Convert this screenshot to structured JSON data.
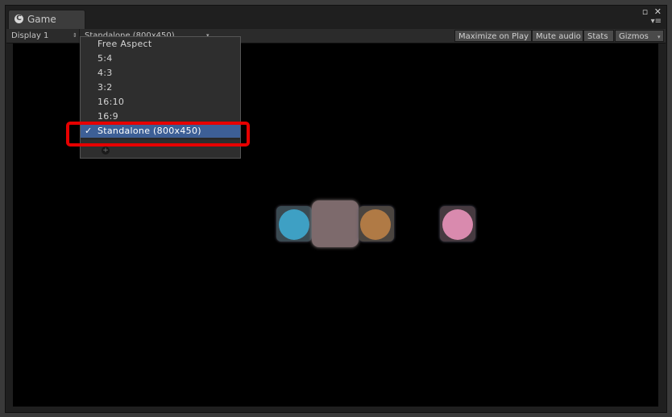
{
  "window": {
    "tab_title": "Game",
    "tab_icon": "unity-logo-icon",
    "controls": {
      "restore": "▫",
      "close": "✕",
      "menu": "▾≡"
    }
  },
  "toolbar": {
    "display": "Display 1",
    "resolution": "Standalone (800x450)",
    "maximize_on_play": "Maximize on Play",
    "mute_audio": "Mute audio",
    "stats": "Stats",
    "gizmos": "Gizmos"
  },
  "aspect_dropdown": {
    "items": [
      {
        "label": "Free Aspect",
        "selected": false
      },
      {
        "label": "5:4",
        "selected": false
      },
      {
        "label": "4:3",
        "selected": false
      },
      {
        "label": "3:2",
        "selected": false
      },
      {
        "label": "16:10",
        "selected": false
      },
      {
        "label": "16:9",
        "selected": false
      },
      {
        "label": "Standalone (800x450)",
        "selected": true
      }
    ],
    "check_glyph": "✓",
    "add_icon": "plus-circle-icon"
  },
  "colors": {
    "highlight": "#e60000",
    "selected_row": "#3d5f96",
    "circle_blue": "#3ea0c4",
    "circle_orange": "#b07a45",
    "circle_pink": "#d98aae",
    "center_square": "#7d6a6c"
  }
}
